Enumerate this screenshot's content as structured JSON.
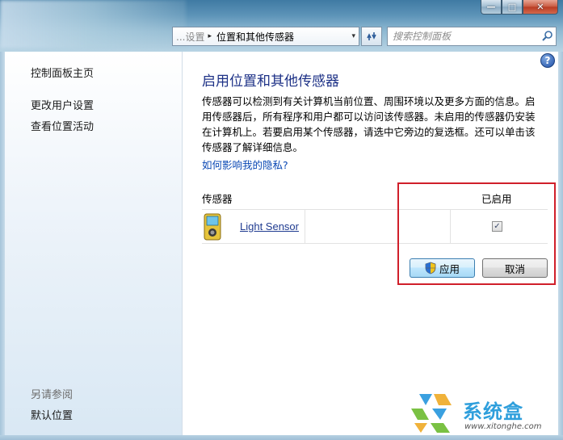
{
  "window": {
    "minimize_glyph": "—",
    "maximize_glyph": "□",
    "close_glyph": "✕"
  },
  "address": {
    "prev_crumb_tail": "...设置",
    "current_crumb": "位置和其他传感器",
    "separator": "▸",
    "dropdown_glyph": "▾"
  },
  "search": {
    "placeholder": "搜索控制面板"
  },
  "sidebar": {
    "home": "控制面板主页",
    "items": [
      {
        "label": "更改用户设置"
      },
      {
        "label": "查看位置活动"
      }
    ],
    "see_also_heading": "另请参阅",
    "see_also_items": [
      {
        "label": "默认位置"
      }
    ]
  },
  "main": {
    "help_glyph": "?",
    "title": "启用位置和其他传感器",
    "description": "传感器可以检测到有关计算机当前位置、周围环境以及更多方面的信息。启用传感器后，所有程序和用户都可以访问该传感器。未启用的传感器仍安装在计算机上。若要启用某个传感器，请选中它旁边的复选框。还可以单击该传感器了解详细信息。",
    "privacy_link": "如何影响我的隐私?",
    "table": {
      "col_sensor": "传感器",
      "col_enabled": "已启用",
      "rows": [
        {
          "name": "Light Sensor",
          "enabled": true,
          "check_glyph": "✓"
        }
      ]
    },
    "buttons": {
      "apply": "应用",
      "cancel": "取消"
    }
  },
  "watermark": {
    "name": "系统盒",
    "url": "www.xitonghe.com"
  },
  "colors": {
    "title_text": "#1e3287",
    "link": "#0a48b4",
    "highlight_border": "#d01f2a",
    "watermark_text": "#2f9fdc"
  }
}
